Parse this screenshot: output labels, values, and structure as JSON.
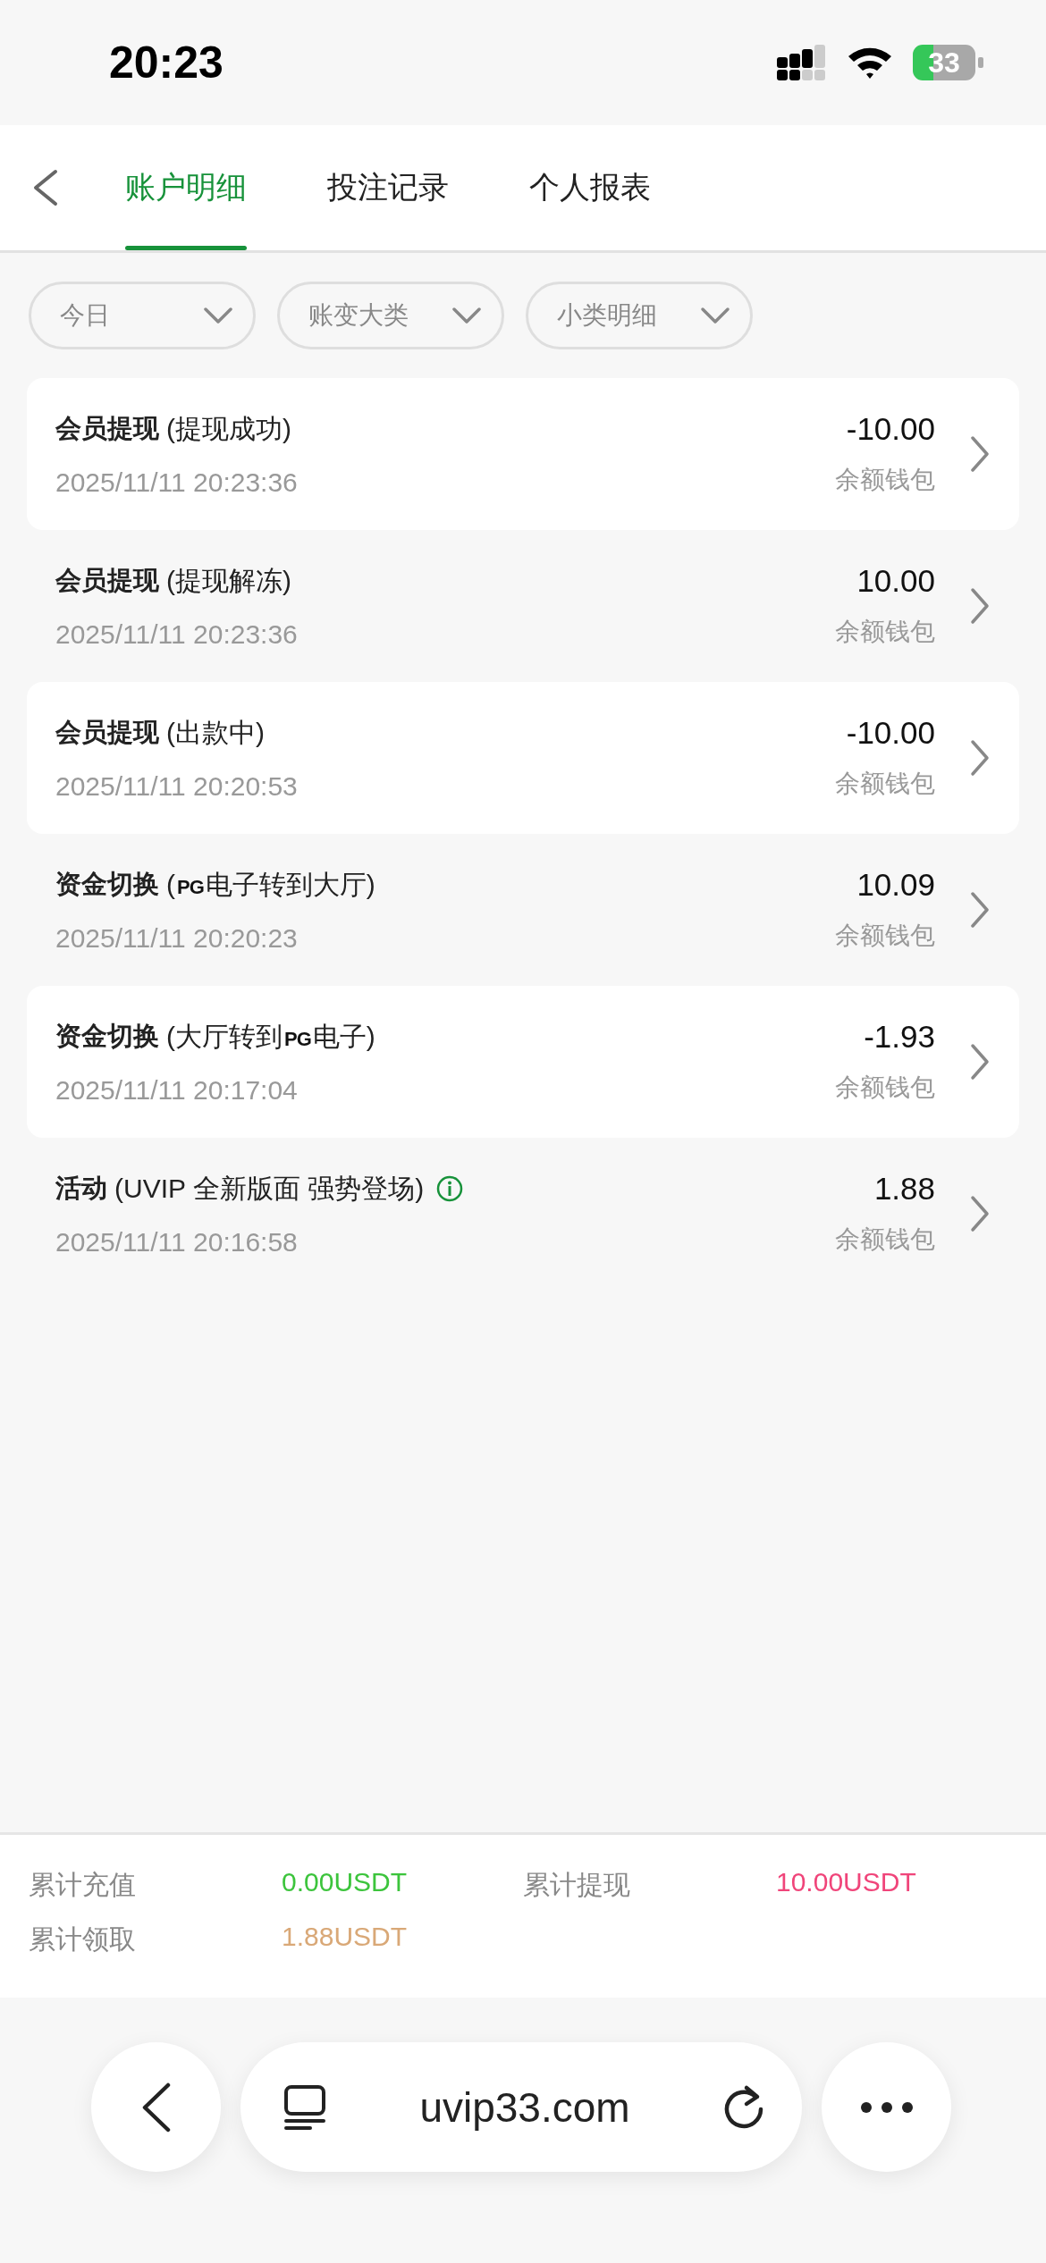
{
  "status_bar": {
    "time": "20:23",
    "battery": "33"
  },
  "tabs": [
    {
      "label": "账户明细",
      "selected": true
    },
    {
      "label": "投注记录",
      "selected": false
    },
    {
      "label": "个人报表",
      "selected": false
    }
  ],
  "filters": [
    {
      "label": "今日"
    },
    {
      "label": "账变大类"
    },
    {
      "label": "小类明细"
    }
  ],
  "records": [
    {
      "title": "会员提现",
      "detail": [
        {
          "kind": "text",
          "text": "(提现成功)"
        }
      ],
      "time": "2025/11/11 20:23:36",
      "amount": "-10.00",
      "wallet": "余额钱包"
    },
    {
      "title": "会员提现",
      "detail": [
        {
          "kind": "text",
          "text": "(提现解冻)"
        }
      ],
      "time": "2025/11/11 20:23:36",
      "amount": "10.00",
      "wallet": "余额钱包"
    },
    {
      "title": "会员提现",
      "detail": [
        {
          "kind": "text",
          "text": "(出款中)"
        }
      ],
      "time": "2025/11/11 20:20:53",
      "amount": "-10.00",
      "wallet": "余额钱包"
    },
    {
      "title": "资金切换",
      "detail": [
        {
          "kind": "text",
          "text": "("
        },
        {
          "kind": "logo",
          "text": "PG"
        },
        {
          "kind": "text",
          "text": "电子转到大厅)"
        }
      ],
      "time": "2025/11/11 20:20:23",
      "amount": "10.09",
      "wallet": "余额钱包"
    },
    {
      "title": "资金切换",
      "detail": [
        {
          "kind": "text",
          "text": "(大厅转到"
        },
        {
          "kind": "logo",
          "text": "PG"
        },
        {
          "kind": "text",
          "text": "电子)"
        }
      ],
      "time": "2025/11/11 20:17:04",
      "amount": "-1.93",
      "wallet": "余额钱包"
    },
    {
      "title": "活动",
      "detail": [
        {
          "kind": "text",
          "text": "(UVIP 全新版面 强势登场)"
        }
      ],
      "info": true,
      "time": "2025/11/11 20:16:58",
      "amount": "1.88",
      "wallet": "余额钱包"
    }
  ],
  "summary": [
    {
      "label": "累计充值",
      "value": "0.00USDT",
      "color": "#3cc43c"
    },
    {
      "label": "累计提现",
      "value": "10.00USDT",
      "color": "#f0457a"
    },
    {
      "label": "累计领取",
      "value": "1.88USDT",
      "color": "#d9a877"
    }
  ],
  "browser": {
    "url": "uvip33.com"
  }
}
